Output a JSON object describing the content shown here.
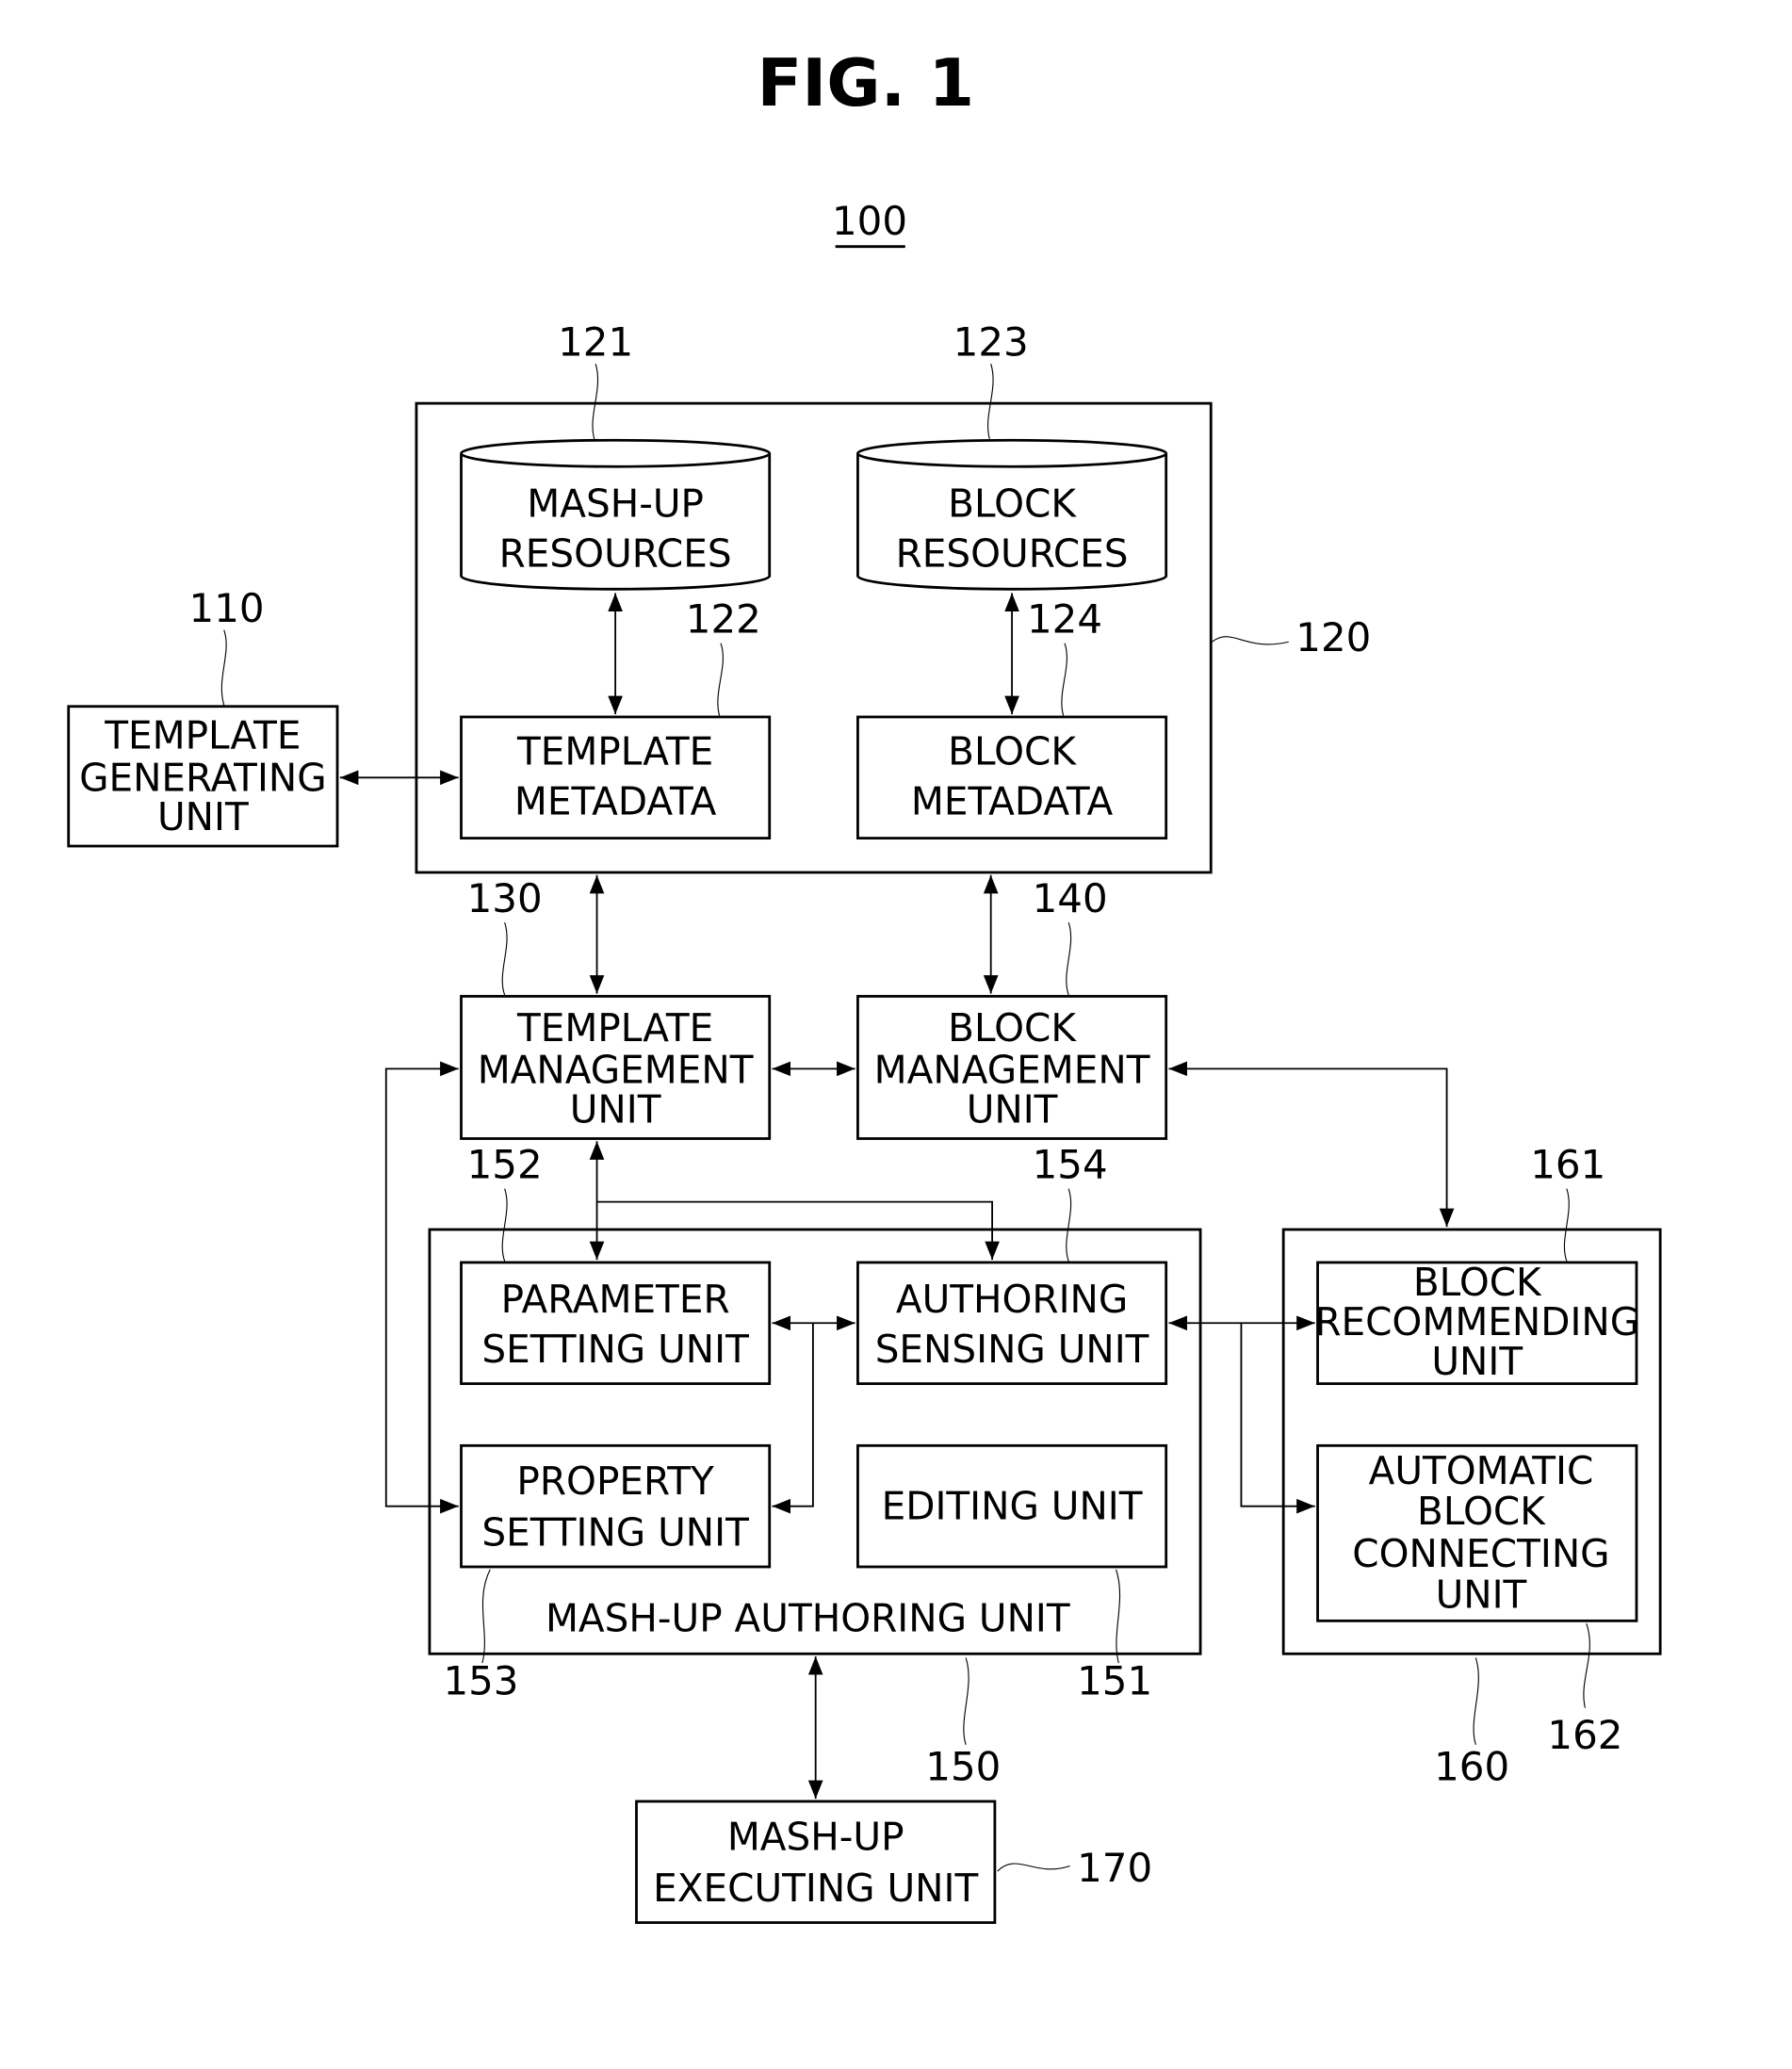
{
  "figure": {
    "title": "FIG. 1",
    "system_ref": "100"
  },
  "blocks": {
    "template_generating_unit": {
      "ref": "110",
      "lines": [
        "TEMPLATE",
        "GENERATING",
        "UNIT"
      ]
    },
    "storage_unit": {
      "ref": "120"
    },
    "mashup_resources": {
      "ref": "121",
      "lines": [
        "MASH-UP",
        "RESOURCES"
      ]
    },
    "template_metadata": {
      "ref": "122",
      "lines": [
        "TEMPLATE",
        "METADATA"
      ]
    },
    "block_resources": {
      "ref": "123",
      "lines": [
        "BLOCK",
        "RESOURCES"
      ]
    },
    "block_metadata": {
      "ref": "124",
      "lines": [
        "BLOCK",
        "METADATA"
      ]
    },
    "template_management_unit": {
      "ref": "130",
      "lines": [
        "TEMPLATE",
        "MANAGEMENT",
        "UNIT"
      ]
    },
    "block_management_unit": {
      "ref": "140",
      "lines": [
        "BLOCK",
        "MANAGEMENT",
        "UNIT"
      ]
    },
    "mashup_authoring_unit": {
      "ref": "150",
      "label": "MASH-UP AUTHORING UNIT"
    },
    "editing_unit": {
      "ref": "151",
      "lines": [
        "EDITING UNIT"
      ]
    },
    "parameter_setting_unit": {
      "ref": "152",
      "lines": [
        "PARAMETER",
        "SETTING UNIT"
      ]
    },
    "property_setting_unit": {
      "ref": "153",
      "lines": [
        "PROPERTY",
        "SETTING UNIT"
      ]
    },
    "authoring_sensing_unit": {
      "ref": "154",
      "lines": [
        "AUTHORING",
        "SENSING UNIT"
      ]
    },
    "recommendation_group": {
      "ref": "160"
    },
    "block_recommending_unit": {
      "ref": "161",
      "lines": [
        "BLOCK",
        "RECOMMENDING",
        "UNIT"
      ]
    },
    "automatic_block_connecting_unit": {
      "ref": "162",
      "lines": [
        "AUTOMATIC",
        "BLOCK",
        "CONNECTING",
        "UNIT"
      ]
    },
    "mashup_executing_unit": {
      "ref": "170",
      "lines": [
        "MASH-UP",
        "EXECUTING UNIT"
      ]
    }
  },
  "connections": [
    {
      "from": "110",
      "to": "122",
      "type": "bidirectional"
    },
    {
      "from": "121",
      "to": "122",
      "type": "bidirectional"
    },
    {
      "from": "123",
      "to": "124",
      "type": "bidirectional"
    },
    {
      "from": "120",
      "to": "130",
      "type": "bidirectional"
    },
    {
      "from": "120",
      "to": "140",
      "type": "bidirectional"
    },
    {
      "from": "130",
      "to": "140",
      "type": "bidirectional"
    },
    {
      "from": "140",
      "to": "161",
      "type": "bidirectional"
    },
    {
      "from": "130",
      "to": "152",
      "type": "bidirectional"
    },
    {
      "from": "130",
      "to": "154",
      "type": "directed"
    },
    {
      "from": "153",
      "to": "130",
      "type": "bidirectional"
    },
    {
      "from": "152",
      "to": "154",
      "type": "bidirectional"
    },
    {
      "from": "154",
      "to": "153",
      "type": "directed"
    },
    {
      "from": "154",
      "to": "161",
      "type": "bidirectional"
    },
    {
      "from": "154",
      "to": "162",
      "type": "directed"
    },
    {
      "from": "150",
      "to": "170",
      "type": "bidirectional"
    }
  ]
}
